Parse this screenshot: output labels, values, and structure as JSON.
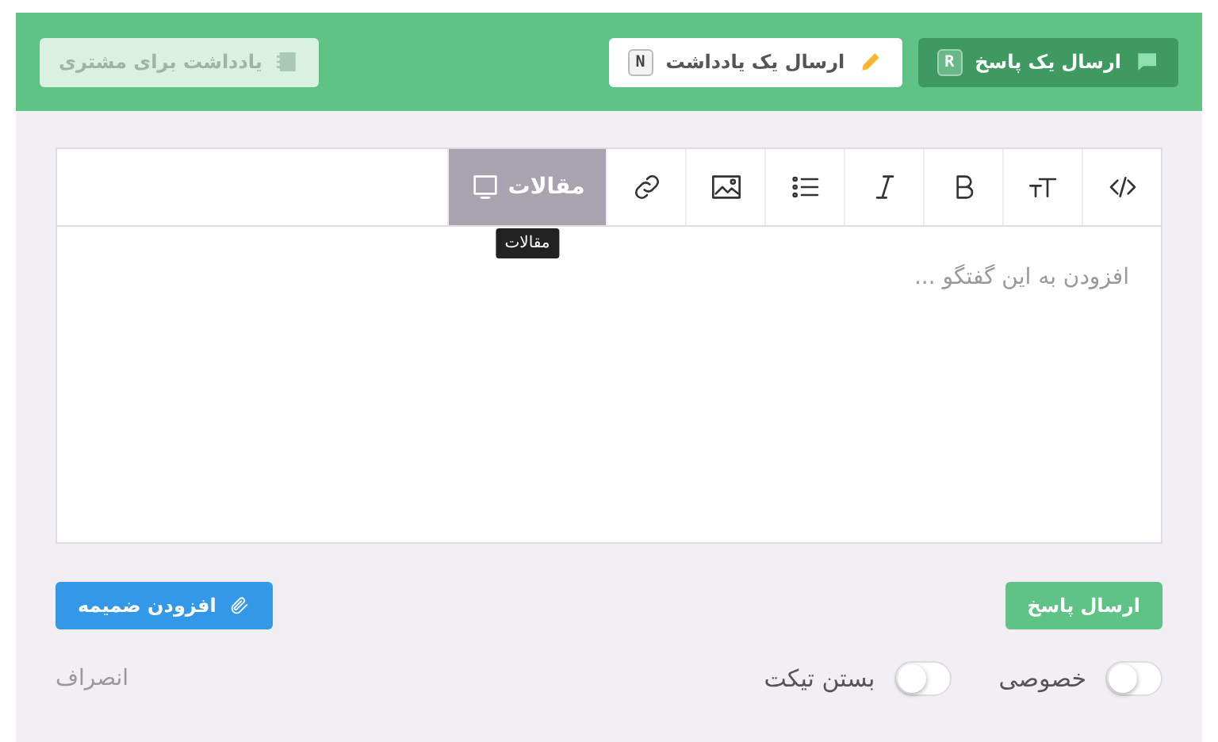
{
  "header_actions": [
    {
      "kind": "reply",
      "label": "ارسال یک پاسخ",
      "shortcut": "R",
      "disabled": false
    },
    {
      "kind": "note",
      "label": "ارسال یک یادداشت",
      "shortcut": "N",
      "disabled": false
    },
    {
      "kind": "customer_note",
      "label": "یادداشت برای مشتری",
      "disabled": true
    }
  ],
  "editor": {
    "toolbar": [
      {
        "kind": "code",
        "active": false
      },
      {
        "kind": "textsize",
        "active": false
      },
      {
        "kind": "bold",
        "active": false
      },
      {
        "kind": "italic",
        "active": false
      },
      {
        "kind": "list",
        "active": false
      },
      {
        "kind": "image",
        "active": false
      },
      {
        "kind": "link",
        "active": false
      },
      {
        "kind": "articles",
        "label": "مقالات",
        "active": true,
        "tooltip": "مقالات"
      }
    ],
    "placeholder": "افزودن به این گفتگو ..."
  },
  "buttons": {
    "submit": "ارسال پاسخ",
    "attach": "افزودن ضمیمه"
  },
  "toggles": [
    {
      "label": "خصوصی",
      "checked": false
    },
    {
      "label": "بستن تیکت",
      "checked": false
    }
  ],
  "cancel": "انصراف"
}
